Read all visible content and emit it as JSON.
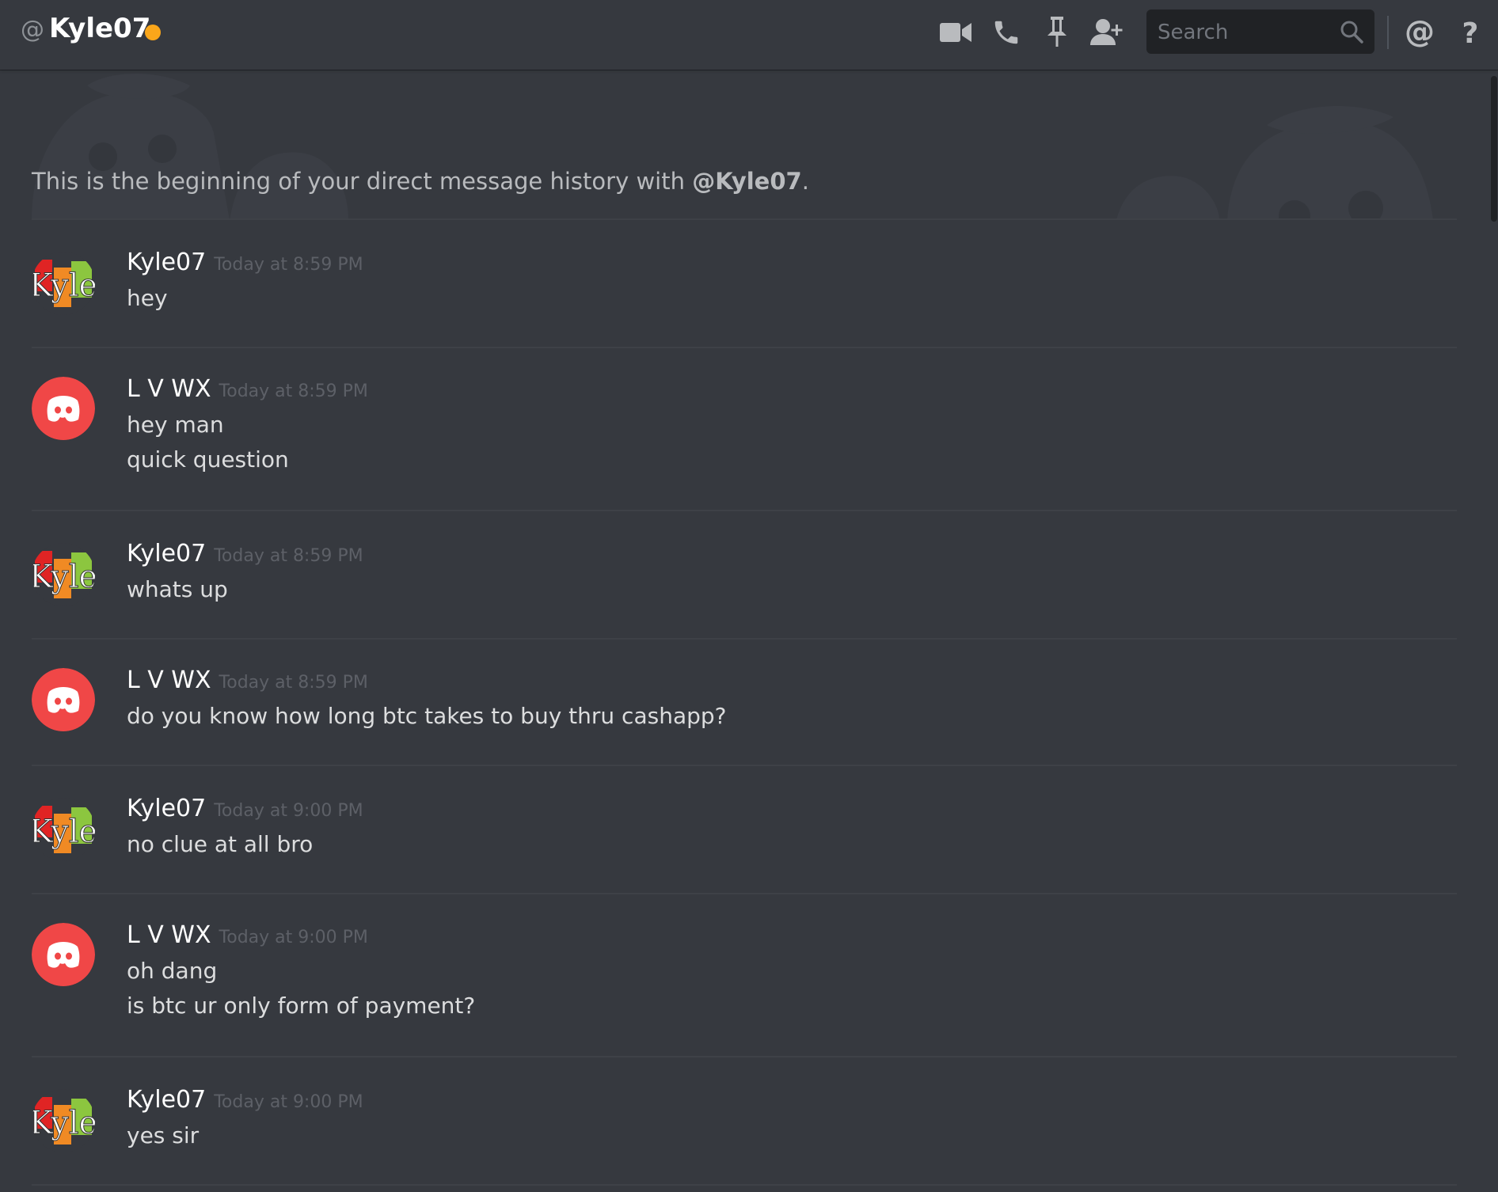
{
  "header": {
    "at_symbol": "@",
    "username": "Kyle07",
    "status_color": "#faa61a",
    "search_placeholder": "Search",
    "icons": [
      "video-call-icon",
      "voice-call-icon",
      "pin-icon",
      "add-friend-icon",
      "search-icon",
      "mentions-icon",
      "help-icon"
    ]
  },
  "intro": {
    "text_prefix": "This is the beginning of your direct message history with ",
    "mention": "@Kyle07",
    "text_suffix": "."
  },
  "messages": [
    {
      "author": "Kyle07",
      "time": "Today at 8:59 PM",
      "lines": [
        "hey"
      ]
    },
    {
      "author": "L V WX",
      "time": "Today at 8:59 PM",
      "lines": [
        "hey man",
        "quick question"
      ]
    },
    {
      "author": "Kyle07",
      "time": "Today at 8:59 PM",
      "lines": [
        "whats up"
      ]
    },
    {
      "author": "L V WX",
      "time": "Today at 8:59 PM",
      "lines": [
        "do you know how long btc takes to buy thru cashapp?"
      ]
    },
    {
      "author": "Kyle07",
      "time": "Today at 9:00 PM",
      "lines": [
        "no clue at all bro"
      ]
    },
    {
      "author": "L V WX",
      "time": "Today at 9:00 PM",
      "lines": [
        "oh dang",
        "is btc ur only form of payment?"
      ]
    },
    {
      "author": "Kyle07",
      "time": "Today at 9:00 PM",
      "lines": [
        "yes sir"
      ]
    }
  ],
  "colors": {
    "background": "#36393f",
    "discord_red": "#f04747",
    "timestamp": "#5d6067"
  }
}
